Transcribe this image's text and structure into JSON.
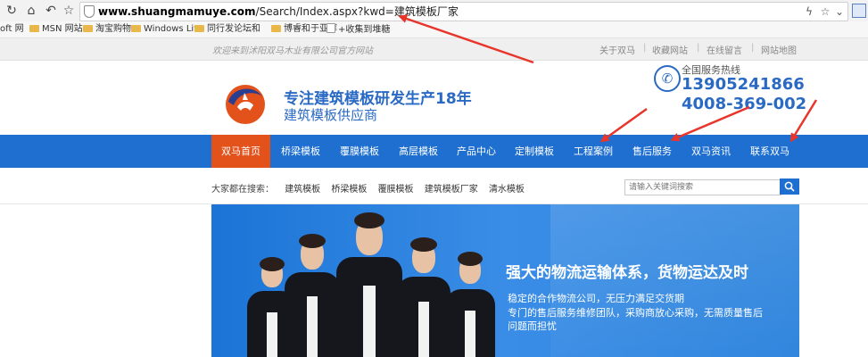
{
  "browser": {
    "url_domain": "www.shuangmamuye.com",
    "url_path": "/Search/Index.aspx?kwd=建筑模板厂家",
    "bookmarks": [
      "oft 网",
      "MSN 网站",
      "淘宝购物",
      "Windows Liv",
      "同行发论坛和",
      "博睿和于亚辉",
      "+收集到堆糖"
    ]
  },
  "topbar": {
    "welcome": "欢迎来到沭阳双马木业有限公司官方网站",
    "links": [
      "关于双马",
      "收藏网站",
      "在线留言",
      "网站地图"
    ]
  },
  "header": {
    "slogan_main": "专注建筑模板研发生产18年",
    "slogan_sub": "建筑模板供应商",
    "hotline_label": "全国服务热线",
    "phone1": "13905241866",
    "phone2": "4008-369-002"
  },
  "nav": {
    "items": [
      "双马首页",
      "桥梁模板",
      "覆膜模板",
      "高层模板",
      "产品中心",
      "定制模板",
      "工程案例",
      "售后服务",
      "双马资讯",
      "联系双马"
    ]
  },
  "breadcrumb": {
    "label": "大家都在搜索：",
    "items": [
      "建筑模板",
      "桥梁模板",
      "覆膜模板",
      "建筑模板厂家",
      "清水模板"
    ]
  },
  "search": {
    "placeholder": "请输入关键词搜索"
  },
  "banner": {
    "title": "强大的物流运输体系，货物运达及时",
    "line1": "稳定的合作物流公司，无压力满足交货期",
    "line2": "专门的售后服务维修团队，采购商放心采购，无需质量售后",
    "line3": "问题而担忧"
  },
  "colors": {
    "nav_blue": "#1e6fd0",
    "nav_active": "#e4521c",
    "brand_blue": "#2a6ac4",
    "arrow_red": "#e8362c"
  }
}
